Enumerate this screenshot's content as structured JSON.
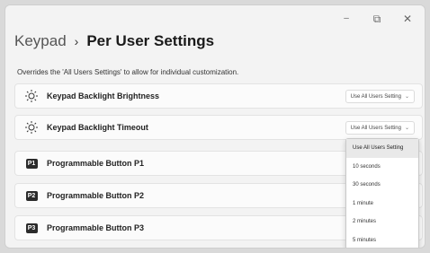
{
  "window": {
    "controls": {
      "minimize": "–",
      "maximize": "⧉",
      "close": "✕"
    }
  },
  "breadcrumb": {
    "root": "Keypad",
    "separator": "›",
    "current": "Per User Settings"
  },
  "description": "Overrides the 'All Users Settings' to allow for individual customization.",
  "settings": [
    {
      "label": "Keypad Backlight Brightness",
      "icon": "brightness-icon",
      "value": "Use All Users Setting"
    },
    {
      "label": "Keypad Backlight Timeout",
      "icon": "brightness-icon",
      "value": "Use All Users Setting"
    },
    {
      "label": "Programmable Button P1",
      "icon": "P1"
    },
    {
      "label": "Programmable Button P2",
      "icon": "P2"
    },
    {
      "label": "Programmable Button P3",
      "icon": "P3"
    }
  ],
  "dropdown": {
    "options": [
      "Use All Users Setting",
      "10 seconds",
      "30 seconds",
      "1 minute",
      "2 minutes",
      "5 minutes"
    ],
    "selected": "Use All Users Setting"
  }
}
